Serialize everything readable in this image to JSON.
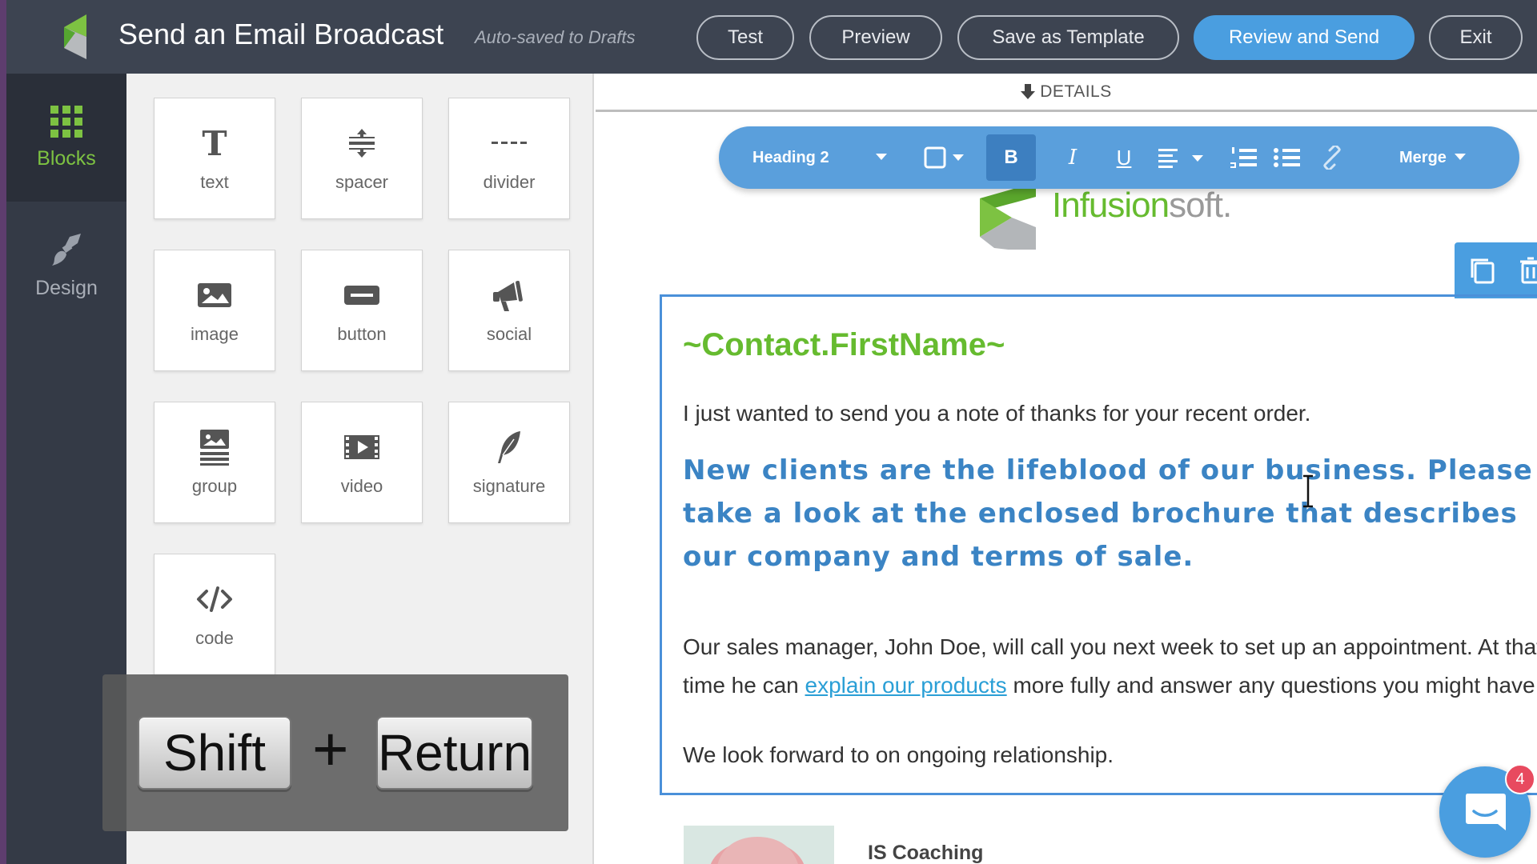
{
  "header": {
    "title": "Send an Email Broadcast",
    "autosave": "Auto-saved to Drafts",
    "buttons": {
      "test": "Test",
      "preview": "Preview",
      "save_template": "Save as Template",
      "review_send": "Review and Send",
      "exit": "Exit"
    }
  },
  "rail": {
    "items": [
      {
        "label": "Blocks",
        "icon": "grid-icon",
        "active": true
      },
      {
        "label": "Design",
        "icon": "paintbrush-icon",
        "active": false
      }
    ]
  },
  "blocks": [
    {
      "label": "text",
      "icon": "text-icon"
    },
    {
      "label": "spacer",
      "icon": "spacer-icon"
    },
    {
      "label": "divider",
      "icon": "divider-icon"
    },
    {
      "label": "image",
      "icon": "image-icon"
    },
    {
      "label": "button",
      "icon": "button-icon"
    },
    {
      "label": "social",
      "icon": "megaphone-icon"
    },
    {
      "label": "group",
      "icon": "group-icon"
    },
    {
      "label": "video",
      "icon": "video-icon"
    },
    {
      "label": "signature",
      "icon": "feather-icon"
    },
    {
      "label": "code",
      "icon": "code-icon"
    }
  ],
  "keys": {
    "shift": "Shift",
    "plus": "+",
    "return": "Return"
  },
  "editor": {
    "details": "DETAILS",
    "toolbar": {
      "style": "Heading 2",
      "bold": "B",
      "italic": "I",
      "underline": "U",
      "merge": "Merge"
    },
    "brand": {
      "part1": "Infusion",
      "part2": "soft."
    },
    "greeting": "~Contact.FirstName~",
    "para1": "I just wanted to send you a note of thanks for your recent order.",
    "heading": "New clients are the lifeblood of our business. Please take a look at the enclosed brochure that describes our company and terms of sale.",
    "para2_before": "Our sales manager, John Doe, will call you next week to set up an appointment. At that time he can ",
    "para2_link": "explain our products",
    "para2_after": " more fully and answer any questions you might have.",
    "para3": "We look forward to on ongoing relationship.",
    "signature_name": "IS Coaching"
  },
  "chat": {
    "badge": "4"
  },
  "colors": {
    "topbar": "#3d4451",
    "accent": "#4a9ee0",
    "green": "#66bb2f",
    "heading_blue": "#3b84c4",
    "badge": "#e84a5f"
  }
}
